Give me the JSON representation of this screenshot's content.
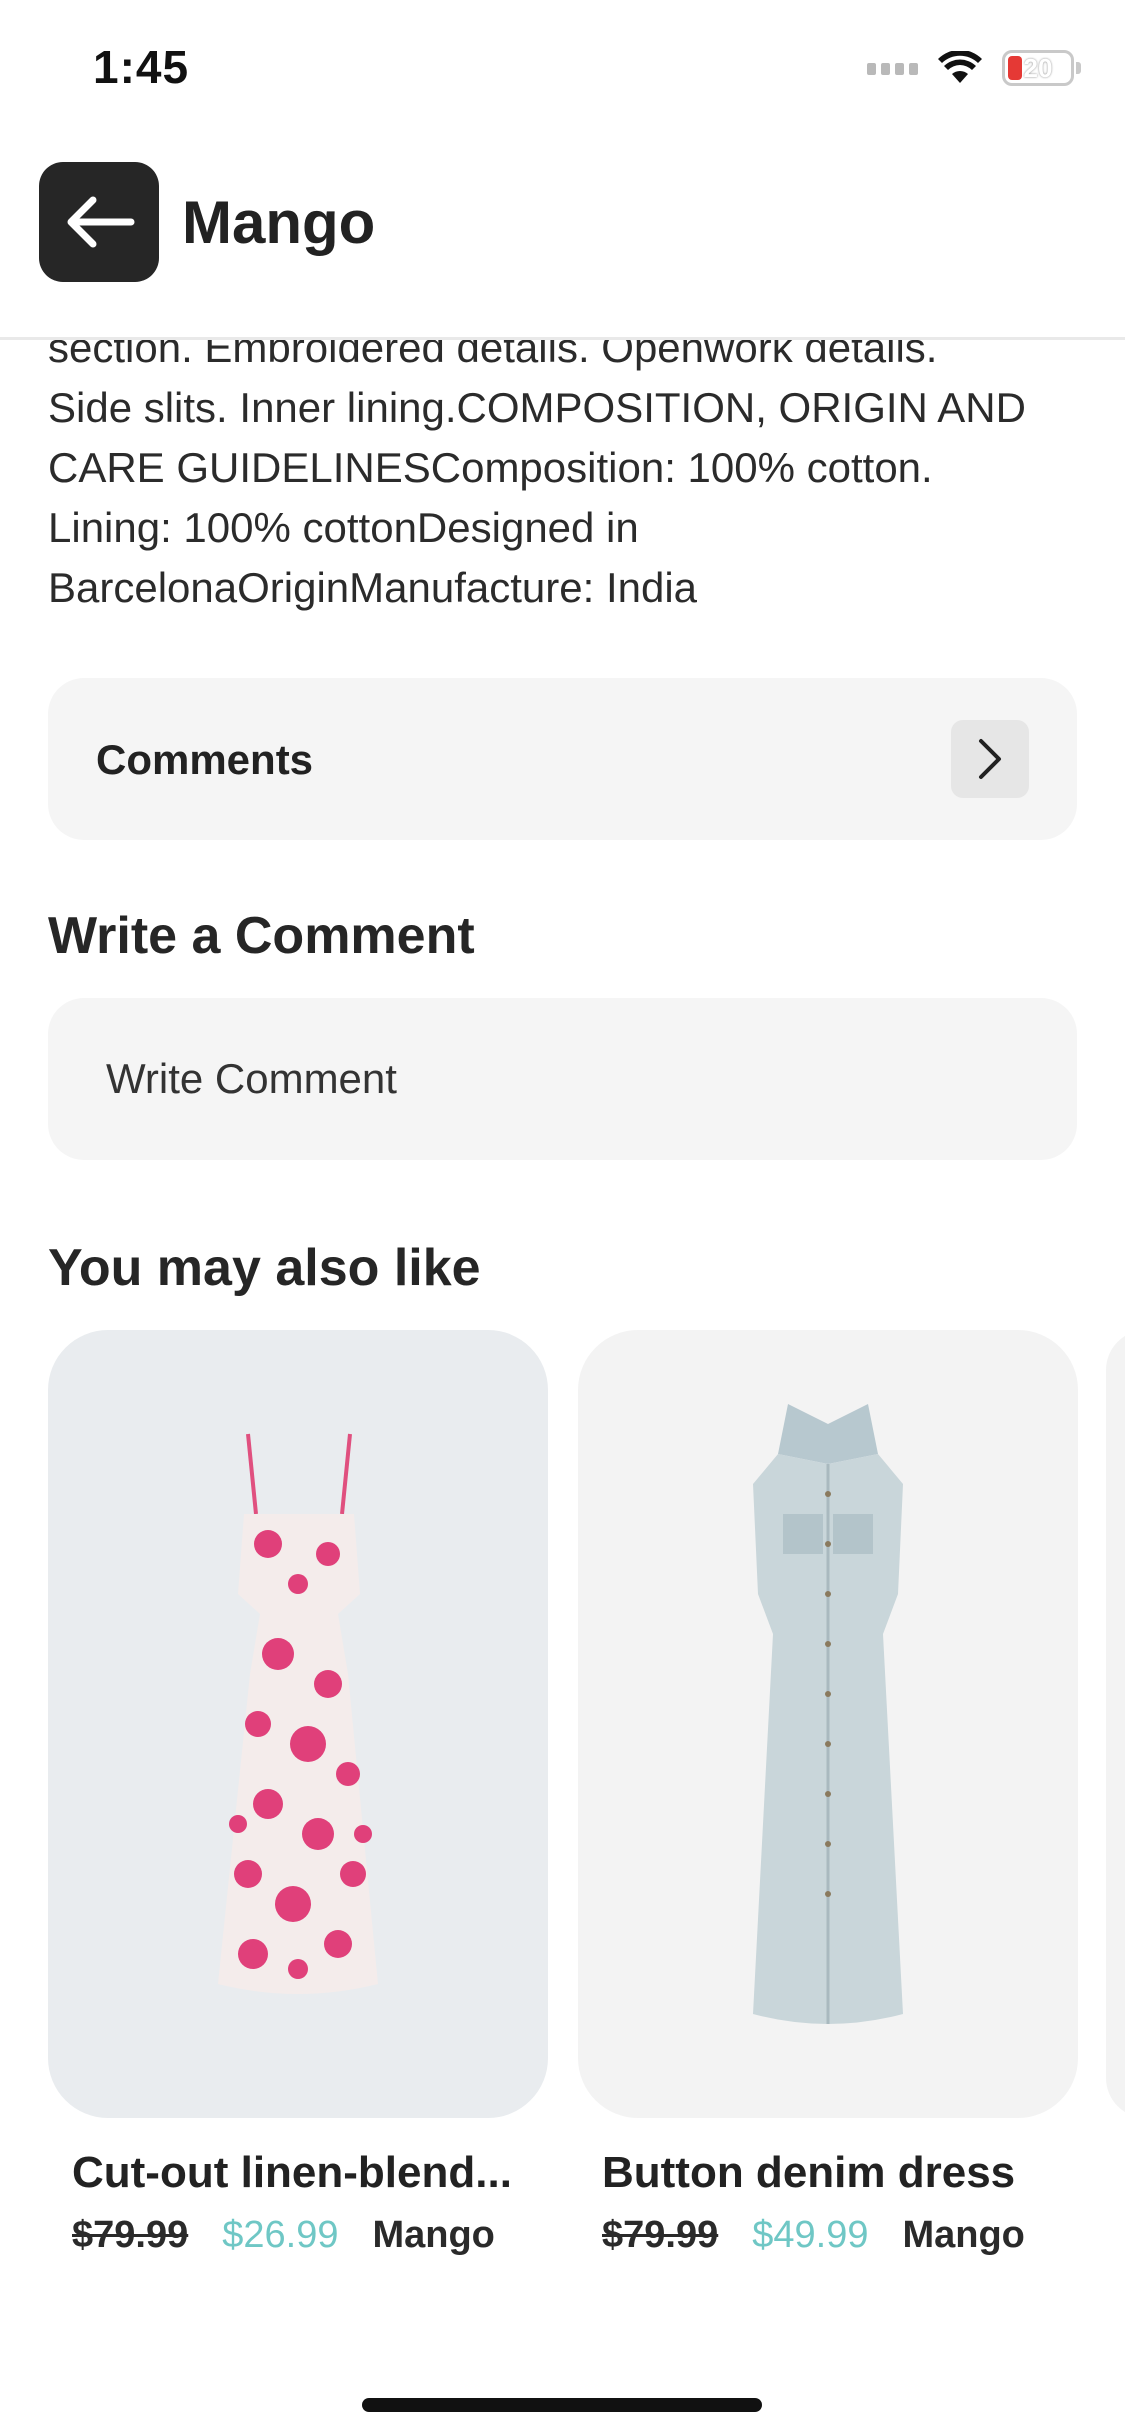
{
  "status_bar": {
    "time": "1:45",
    "battery_level": "20",
    "icons": [
      "cellular-signal-icon",
      "wifi-icon",
      "battery-icon"
    ]
  },
  "header": {
    "title": "Mango",
    "back_icon": "arrow-left-icon"
  },
  "description": {
    "lines": [
      "section. Embroidered details. Openwork details.",
      "Side slits. Inner lining.COMPOSITION, ORIGIN AND",
      "CARE GUIDELINESComposition: 100% cotton.",
      "Lining: 100% cottonDesigned in",
      "BarcelonaOriginManufacture: India"
    ]
  },
  "comments": {
    "label": "Comments",
    "icon": "chevron-right-icon"
  },
  "write_comment": {
    "title": "Write a Comment",
    "placeholder": "Write Comment"
  },
  "recommendations": {
    "title": "You may also like",
    "products": [
      {
        "name": "Cut-out linen-blend...",
        "old_price": "$79.99",
        "new_price": "$26.99",
        "brand": "Mango"
      },
      {
        "name": "Button denim dress",
        "old_price": "$79.99",
        "new_price": "$49.99",
        "brand": "Mango"
      }
    ]
  },
  "colors": {
    "accent_price": "#6fc7c5",
    "back_button": "#262626",
    "card_background": "#f5f5f5"
  }
}
